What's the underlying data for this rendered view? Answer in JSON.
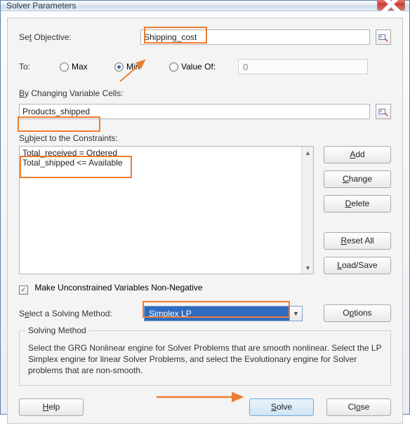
{
  "window": {
    "title": "Solver Parameters"
  },
  "labels": {
    "set_objective": "Set Objective:",
    "to": "To:",
    "max": "Max",
    "min": "Min",
    "value_of": "Value Of:",
    "by_changing": "By Changing Variable Cells:",
    "subject_to": "Subject to the Constraints:",
    "make_nonneg": "Make Unconstrained Variables Non-Negative",
    "select_method": "Select a Solving Method:",
    "solving_method": "Solving Method",
    "description": "Select the GRG Nonlinear engine for Solver Problems that are smooth nonlinear. Select the LP Simplex engine for linear Solver Problems, and select the Evolutionary engine for Solver problems that are non-smooth."
  },
  "fields": {
    "objective": "Shipping_cost",
    "value_of": "0",
    "changing_cells": "Products_shipped",
    "solving_method": "Simplex LP",
    "make_nonneg_checked": true,
    "to_selected": "min"
  },
  "constraints": [
    "Total_received = Ordered",
    "Total_shipped <= Available"
  ],
  "buttons": {
    "add": "Add",
    "change": "Change",
    "delete": "Delete",
    "reset_all": "Reset All",
    "load_save": "Load/Save",
    "options": "Options",
    "help": "Help",
    "solve": "Solve",
    "close": "Close"
  }
}
